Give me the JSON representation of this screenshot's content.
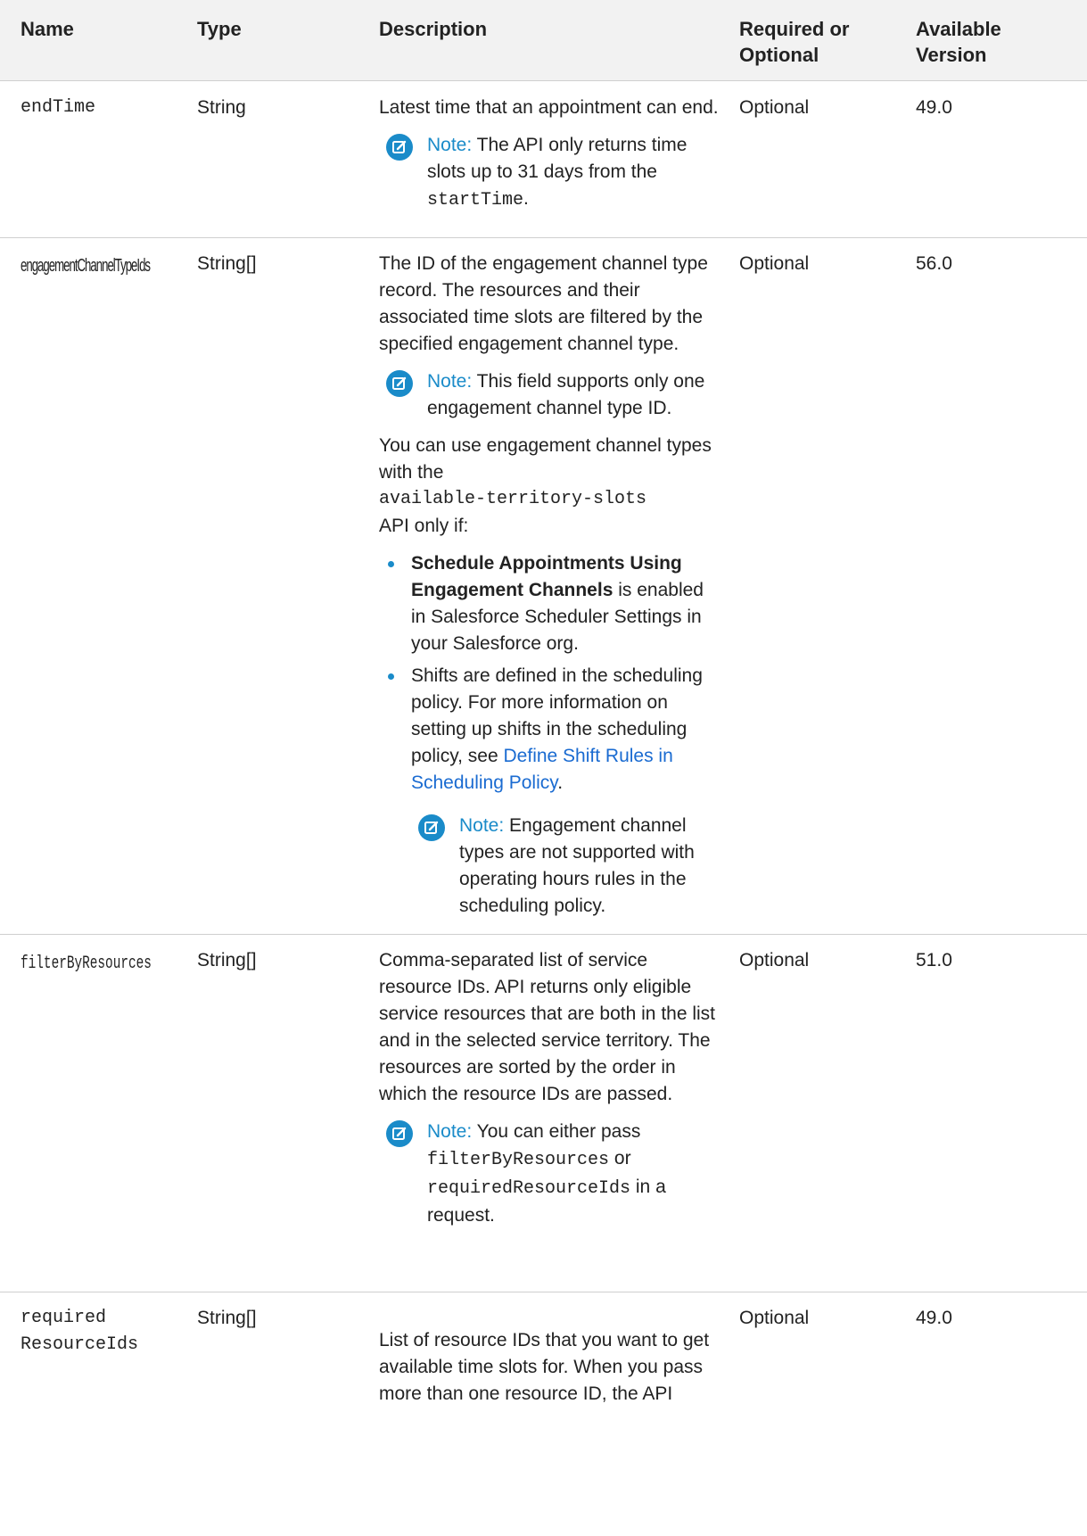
{
  "header": {
    "name": "Name",
    "type": "Type",
    "description": "Description",
    "required_line1": "Required or",
    "required_line2": "Optional",
    "version_line1": "Available",
    "version_line2": "Version"
  },
  "rows": [
    {
      "name": "endTime",
      "type": "String",
      "desc": "Latest time that an appointment can end.",
      "note_label": "Note:",
      "note_text": "The API only returns time slots up to 31 days from the",
      "note_code": "startTime",
      "note_end": ".",
      "required": "Optional",
      "version": "49.0"
    },
    {
      "name": "engagementChannelTypeIds",
      "type": "String[]",
      "desc": "The ID of the engagement channel type record. The resources and their associated time slots are filtered by the specified engagement channel type.",
      "note_label": "Note:",
      "note_text": "This field supports only one engagement channel type ID.",
      "para2_a": "You can use engagement channel types with the",
      "para2_code": "available-territory-slots",
      "para2_b": "API only if:",
      "bullet1_bold": "Schedule Appointments Using Engagement Channels",
      "bullet1_rest": "is enabled in Salesforce Scheduler Settings in your Salesforce org.",
      "bullet2_text": "Shifts are defined in the scheduling policy. For more information on setting up shifts in the scheduling policy, see",
      "bullet2_link": "Define Shift Rules in Scheduling Policy",
      "bullet2_end": ".",
      "note2_label": "Note:",
      "note2_text": "Engagement channel types are not supported with operating hours rules in the scheduling policy.",
      "required": "Optional",
      "version": "56.0"
    },
    {
      "name": "filterByResources",
      "type": "String[]",
      "desc": "Comma-separated list of service resource IDs. API returns only eligible service resources that are both in the list and in the selected service territory. The resources are sorted by the order in which the resource IDs are passed.",
      "note_label": "Note:",
      "note_text": "You can either pass",
      "note_code1": "filterByResources",
      "note_or": "or",
      "note_code2": "requiredResourceIds",
      "note_in": "in",
      "note_end": "a request.",
      "required": "Optional",
      "version": "51.0"
    },
    {
      "name_line1": "required",
      "name_line2": "ResourceIds",
      "type": "String[]",
      "desc": "List of resource IDs that you want to get available time slots for. When you pass more than one resource ID, the API",
      "required": "Optional",
      "version": "49.0"
    }
  ],
  "icons": {
    "note": "note-edit-icon",
    "note_color": "#1a8bc9"
  }
}
